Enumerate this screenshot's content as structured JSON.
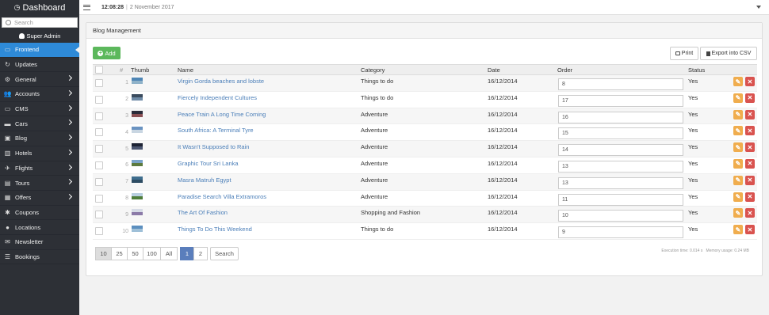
{
  "sidebar": {
    "title": "Dashboard",
    "search_placeholder": "Search",
    "user": "Super Admin",
    "items": [
      {
        "label": "Frontend",
        "icon": "laptop-icon",
        "active": true,
        "chevron": false
      },
      {
        "label": "Updates",
        "icon": "refresh-icon",
        "active": false,
        "chevron": false
      },
      {
        "label": "General",
        "icon": "cogs-icon",
        "active": false,
        "chevron": true
      },
      {
        "label": "Accounts",
        "icon": "users-icon",
        "active": false,
        "chevron": true
      },
      {
        "label": "CMS",
        "icon": "monitor-icon",
        "active": false,
        "chevron": true
      },
      {
        "label": "Cars",
        "icon": "car-icon",
        "active": false,
        "chevron": true
      },
      {
        "label": "Blog",
        "icon": "blog-icon",
        "active": false,
        "chevron": true
      },
      {
        "label": "Hotels",
        "icon": "building-icon",
        "active": false,
        "chevron": true
      },
      {
        "label": "Flights",
        "icon": "plane-icon",
        "active": false,
        "chevron": true
      },
      {
        "label": "Tours",
        "icon": "suitcase-icon",
        "active": false,
        "chevron": true
      },
      {
        "label": "Offers",
        "icon": "gift-icon",
        "active": false,
        "chevron": true
      },
      {
        "label": "Coupons",
        "icon": "asterisk-icon",
        "active": false,
        "chevron": false
      },
      {
        "label": "Locations",
        "icon": "map-marker-icon",
        "active": false,
        "chevron": false
      },
      {
        "label": "Newsletter",
        "icon": "envelope-icon",
        "active": false,
        "chevron": false
      },
      {
        "label": "Bookings",
        "icon": "list-icon",
        "active": false,
        "chevron": false
      }
    ]
  },
  "topbar": {
    "time": "12:08:28",
    "separator": "|",
    "date": "2 November 2017"
  },
  "panel": {
    "title": "Blog Management",
    "add_label": "Add",
    "print_label": "Print",
    "csv_label": "Export into CSV"
  },
  "table": {
    "headers": {
      "num": "#",
      "thumb": "Thumb",
      "name": "Name",
      "category": "Category",
      "date": "Date",
      "order": "Order",
      "status": "Status"
    },
    "rows": [
      {
        "num": "1",
        "name": "Virgin Gorda beaches and lobste",
        "category": "Things to do",
        "date": "16/12/2014",
        "order": "8",
        "status": "Yes",
        "thumb_colors": [
          "#4f86b5",
          "#8fb2c9"
        ]
      },
      {
        "num": "2",
        "name": "Fiercely Independent Cultures",
        "category": "Things to do",
        "date": "16/12/2014",
        "order": "17",
        "status": "Yes",
        "thumb_colors": [
          "#3a4b5e",
          "#6e8aa6"
        ]
      },
      {
        "num": "3",
        "name": "Peace Train A Long Time Coming",
        "category": "Adventure",
        "date": "16/12/2014",
        "order": "16",
        "status": "Yes",
        "thumb_colors": [
          "#2b2c3a",
          "#8a4f53"
        ]
      },
      {
        "num": "4",
        "name": "South Africa: A Terminal Tyre",
        "category": "Adventure",
        "date": "16/12/2014",
        "order": "15",
        "status": "Yes",
        "thumb_colors": [
          "#6a93c1",
          "#c9d6e2"
        ]
      },
      {
        "num": "5",
        "name": "It Wasn't Supposed to Rain",
        "category": "Adventure",
        "date": "16/12/2014",
        "order": "14",
        "status": "Yes",
        "thumb_colors": [
          "#1c2233",
          "#4a5570"
        ]
      },
      {
        "num": "6",
        "name": "Graphic Tour Sri Lanka",
        "category": "Adventure",
        "date": "16/12/2014",
        "order": "13",
        "status": "Yes",
        "thumb_colors": [
          "#7aa3c8",
          "#5d7a3e"
        ]
      },
      {
        "num": "7",
        "name": "Masra Matruh Egypt",
        "category": "Adventure",
        "date": "16/12/2014",
        "order": "13",
        "status": "Yes",
        "thumb_colors": [
          "#3f6e8e",
          "#2d4c63"
        ]
      },
      {
        "num": "8",
        "name": "Paradise Search Villa Extramoros",
        "category": "Adventure",
        "date": "16/12/2014",
        "order": "11",
        "status": "Yes",
        "thumb_colors": [
          "#b9cfe0",
          "#4e7d3a"
        ]
      },
      {
        "num": "9",
        "name": "The Art Of Fashion",
        "category": "Shopping and Fashion",
        "date": "16/12/2014",
        "order": "10",
        "status": "Yes",
        "thumb_colors": [
          "#d6dbe6",
          "#8b7aa8"
        ]
      },
      {
        "num": "10",
        "name": "Things To Do This Weekend",
        "category": "Things to do",
        "date": "16/12/2014",
        "order": "9",
        "status": "Yes",
        "thumb_colors": [
          "#5c8fbf",
          "#9fc0d8"
        ]
      }
    ]
  },
  "pager": {
    "sizes": [
      "10",
      "25",
      "50",
      "100",
      "All"
    ],
    "selected_size": "10",
    "pages": [
      "1",
      "2"
    ],
    "current_page": "1",
    "search_label": "Search"
  },
  "footer": {
    "exec_time": "Execution time: 0.014 s",
    "memory": "Memory usage: 0.24 MB"
  },
  "colors": {
    "sidebar_bg": "#2d3036",
    "active": "#2e8ad8",
    "add_button": "#5cb85c",
    "edit_button": "#f0ad4e",
    "delete_button": "#d9534f",
    "link": "#4a7eb8"
  }
}
